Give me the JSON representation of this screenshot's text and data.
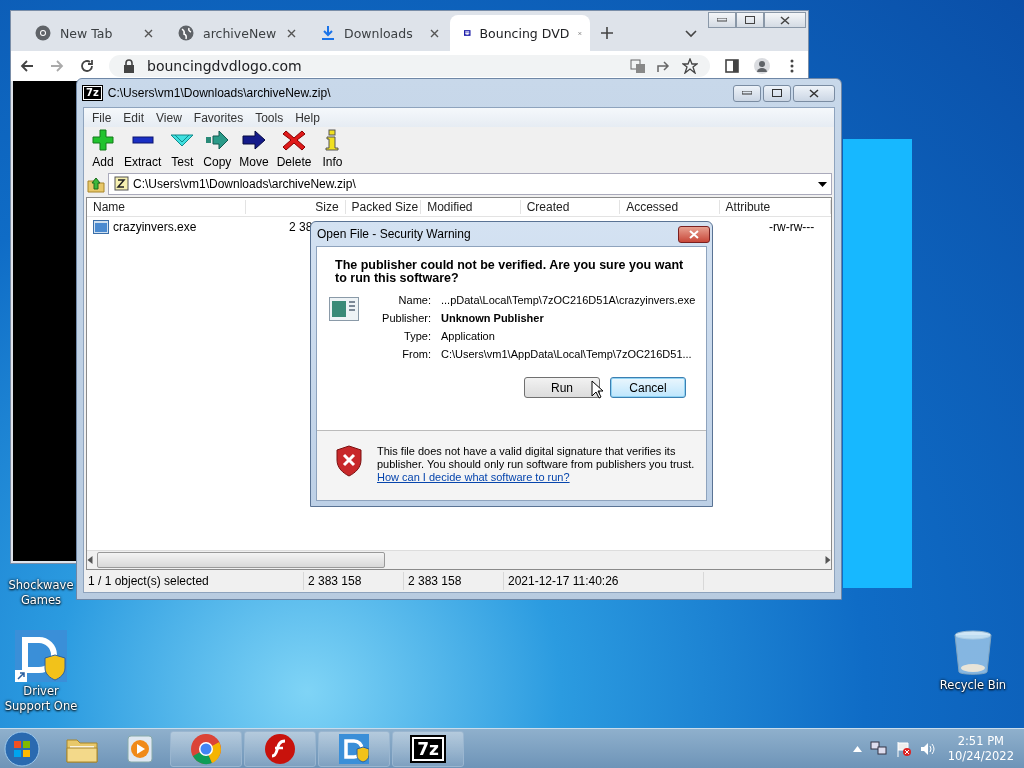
{
  "browser": {
    "tabs": [
      {
        "label": "New Tab",
        "kind": "chrome",
        "selected": false
      },
      {
        "label": "archiveNew",
        "kind": "globe",
        "selected": false
      },
      {
        "label": "Downloads",
        "kind": "download",
        "selected": false
      },
      {
        "label": "Bouncing DVD",
        "kind": "dvd",
        "selected": true
      }
    ],
    "url": "bouncingdvdlogo.com"
  },
  "archive_window": {
    "app_icon_text": "7z",
    "title": "C:\\Users\\vm1\\Downloads\\archiveNew.zip\\",
    "menu": [
      "File",
      "Edit",
      "View",
      "Favorites",
      "Tools",
      "Help"
    ],
    "toolbar": [
      {
        "label": "Add",
        "kind": "add"
      },
      {
        "label": "Extract",
        "kind": "extract"
      },
      {
        "label": "Test",
        "kind": "test"
      },
      {
        "label": "Copy",
        "kind": "copy"
      },
      {
        "label": "Move",
        "kind": "move"
      },
      {
        "label": "Delete",
        "kind": "delete"
      },
      {
        "label": "Info",
        "kind": "info"
      }
    ],
    "path": "C:\\Users\\vm1\\Downloads\\archiveNew.zip\\",
    "columns": [
      "Name",
      "Size",
      "Packed Size",
      "Modified",
      "Created",
      "Accessed",
      "Attribute"
    ],
    "rows": [
      {
        "name": "crazyinvers.exe",
        "size": "2 38",
        "attributes": "-rw-rw---"
      }
    ],
    "status_bar": [
      "1 / 1 object(s) selected",
      "2 383 158",
      "2 383 158",
      "2021-12-17 11:40:26"
    ]
  },
  "security_dialog": {
    "title": "Open File - Security Warning",
    "heading": "The publisher could not be verified.  Are you sure you want to run this software?",
    "fields": [
      {
        "label": "Name:",
        "value": "...pData\\Local\\Temp\\7zOC216D51A\\crazyinvers.exe",
        "bold": false
      },
      {
        "label": "Publisher:",
        "value": "Unknown Publisher",
        "bold": true
      },
      {
        "label": "Type:",
        "value": "Application",
        "bold": false
      },
      {
        "label": "From:",
        "value": "C:\\Users\\vm1\\AppData\\Local\\Temp\\7zOC216D51...",
        "bold": false
      }
    ],
    "buttons": [
      {
        "label": "Run",
        "default": false
      },
      {
        "label": "Cancel",
        "default": true
      }
    ],
    "warning": "This file does not have a valid digital signature that verifies its publisher.  You should only run software from publishers you trust.",
    "link": "How can I decide what software to run?"
  },
  "desktop_icons": [
    {
      "label": "Shockwave Games",
      "kind": "shockwave"
    },
    {
      "label": "Driver Support One",
      "kind": "driver"
    },
    {
      "label": "Recycle Bin",
      "kind": "recycle"
    }
  ],
  "taskbar": {
    "apps": [
      {
        "kind": "explorer"
      },
      {
        "kind": "media"
      },
      {
        "kind": "chrome"
      },
      {
        "kind": "flash"
      },
      {
        "kind": "driver"
      },
      {
        "kind": "sevenzip",
        "text": "7z"
      }
    ],
    "time": "2:51 PM",
    "date": "10/24/2022"
  }
}
